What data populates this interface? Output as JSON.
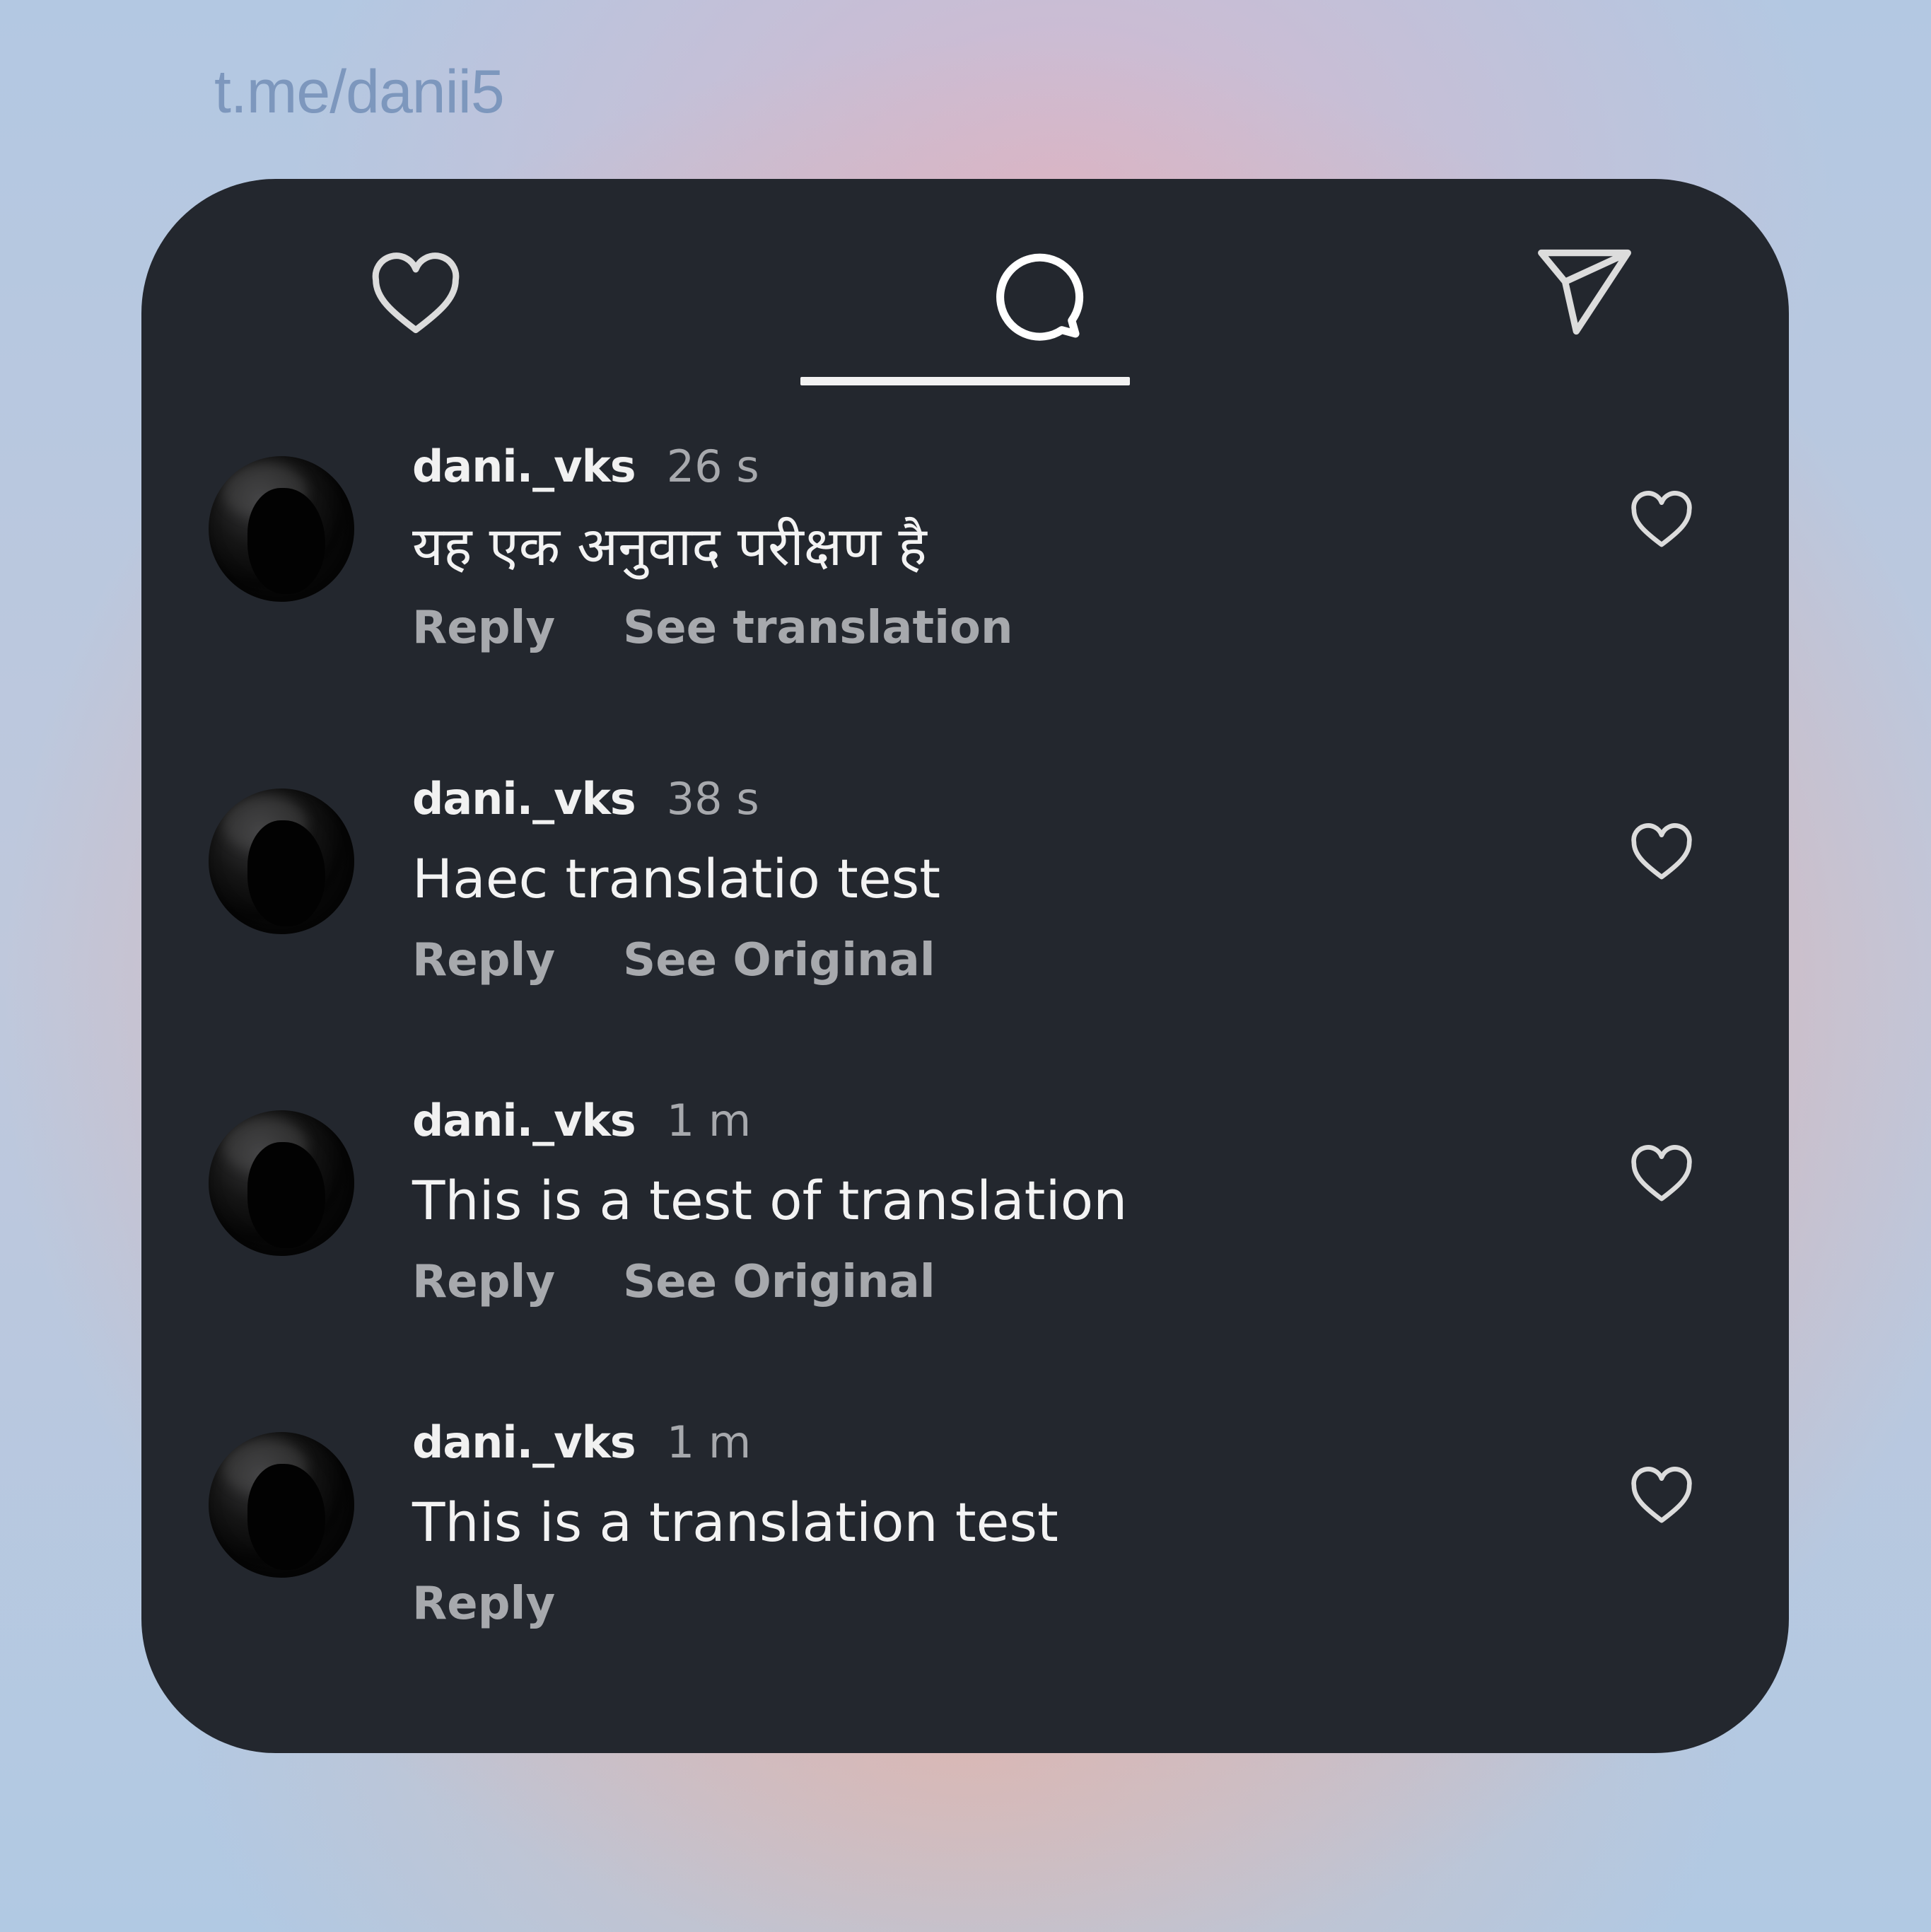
{
  "watermark": "t.me/danii5",
  "tabs": [
    {
      "icon": "heart-icon",
      "active": false
    },
    {
      "icon": "comment-bubble-icon",
      "active": true
    },
    {
      "icon": "paper-plane-icon",
      "active": false
    }
  ],
  "comments": [
    {
      "username": "dani._vks",
      "time": "26 s",
      "text": "यह एक अनुवाद परीक्षण है",
      "reply_label": "Reply",
      "translate_label": "See translation"
    },
    {
      "username": "dani._vks",
      "time": "38 s",
      "text": "Haec translatio test",
      "reply_label": "Reply",
      "translate_label": "See Original"
    },
    {
      "username": "dani._vks",
      "time": "1 m",
      "text": "This is a test of translation",
      "reply_label": "Reply",
      "translate_label": "See Original"
    },
    {
      "username": "dani._vks",
      "time": "1 m",
      "text": "This is a translation test",
      "reply_label": "Reply",
      "translate_label": null
    }
  ],
  "colors": {
    "card_background": "#23272e",
    "primary_text": "#f3f3f3",
    "secondary_text": "#a7a9ad",
    "icon_stroke": "#dcdcdc",
    "watermark": "#7d97bd"
  }
}
